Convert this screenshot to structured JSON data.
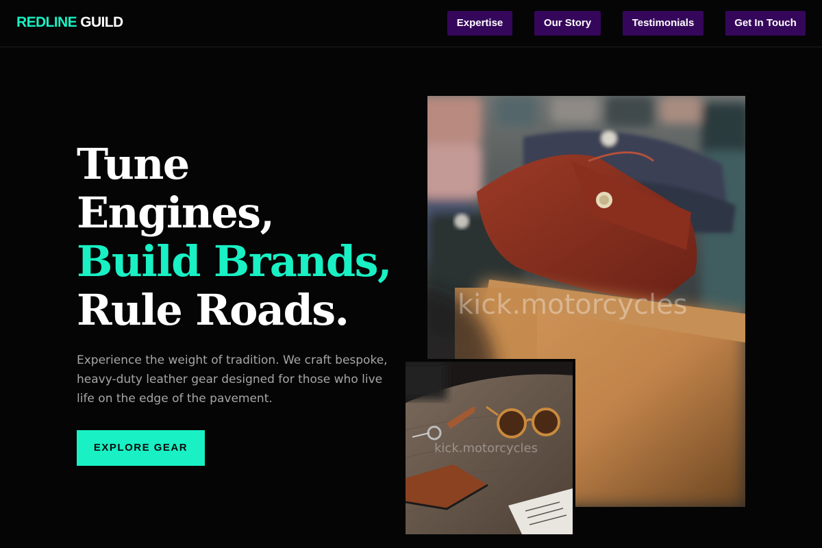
{
  "header": {
    "logo_accent": "REDLINE",
    "logo_rest": " GUILD",
    "nav": [
      "Expertise",
      "Our Story",
      "Testimonials",
      "Get In Touch"
    ]
  },
  "hero": {
    "headline": [
      "Tune",
      "Engines,",
      "Build Brands,",
      "Rule Roads."
    ],
    "subtitle": "Experience the weight of tradition. We craft bespoke, heavy-duty leather gear designed for those who live life on the edge of the pavement.",
    "cta": "EXPLORE GEAR"
  },
  "images": {
    "main_watermark": "kick.motorcycles",
    "small_watermark": "kick.motorcycles"
  },
  "colors": {
    "accent": "#19f0c4",
    "nav_button_bg": "#35075b",
    "background": "#050505",
    "subtitle_text": "#a7a7a7"
  }
}
